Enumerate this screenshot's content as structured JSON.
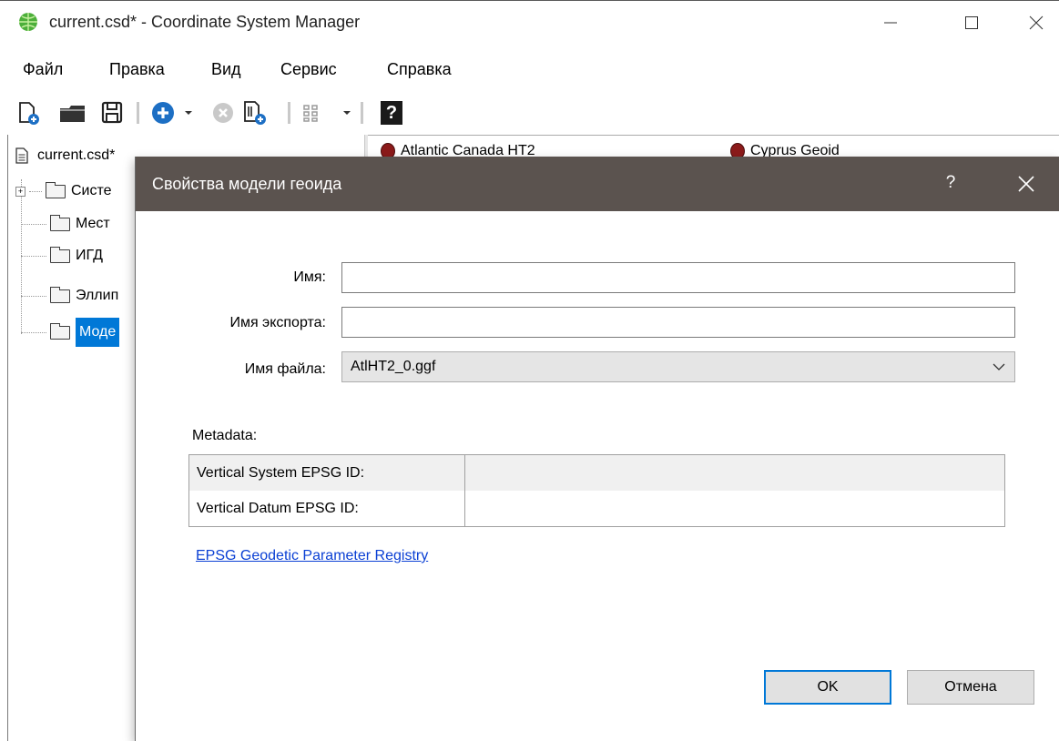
{
  "window": {
    "title": "current.csd* - Coordinate System Manager"
  },
  "menu": {
    "items": [
      "Файл",
      "Правка",
      "Вид",
      "Сервис",
      "Справка"
    ]
  },
  "toolbar": {
    "icons": [
      "new-file-icon",
      "open-folder-icon",
      "save-icon",
      "add-icon",
      "dropdown-arrow-icon",
      "delete-icon",
      "copy-icon",
      "properties-icon",
      "dropdown-arrow-icon",
      "help-icon"
    ],
    "help_glyph": "?"
  },
  "tree": {
    "root": "current.csd*",
    "folders": [
      "Систе",
      "Мест",
      "ИГД",
      "Эллип",
      "Моде"
    ],
    "selected_index": 4
  },
  "tabs": {
    "items": [
      "Atlantic Canada HT2",
      "Cyprus Geoid"
    ]
  },
  "dialog": {
    "title": "Свойства модели геоида",
    "help": "?",
    "fields": {
      "name_label": "Имя:",
      "name_value": "",
      "export_label": "Имя экспорта:",
      "export_value": "",
      "file_label": "Имя файла:",
      "file_value": "AtlHT2_0.ggf"
    },
    "metadata": {
      "label": "Metadata:",
      "rows": [
        {
          "key": "Vertical System EPSG ID:",
          "value": ""
        },
        {
          "key": "Vertical Datum EPSG ID:",
          "value": ""
        }
      ]
    },
    "link": "EPSG Geodetic Parameter Registry",
    "ok": "OK",
    "cancel": "Отмена"
  },
  "colors": {
    "dialog_header": "#5b534f",
    "selection": "#0078d7",
    "link": "#0b40d4"
  }
}
